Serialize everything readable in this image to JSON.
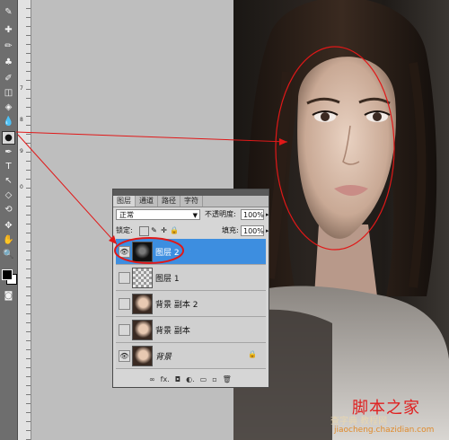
{
  "toolbar": {
    "tools": [
      {
        "name": "eyedropper-tool",
        "glyph": "✎"
      },
      {
        "name": "healing-tool",
        "glyph": "✚"
      },
      {
        "name": "brush-tool",
        "glyph": "✏"
      },
      {
        "name": "stamp-tool",
        "glyph": "♣"
      },
      {
        "name": "history-brush-tool",
        "glyph": "✐"
      },
      {
        "name": "eraser-tool",
        "glyph": "◫"
      },
      {
        "name": "bucket-tool",
        "glyph": "◈"
      },
      {
        "name": "blur-tool",
        "glyph": "💧"
      },
      {
        "name": "dodge-tool",
        "glyph": "●"
      },
      {
        "name": "pen-tool",
        "glyph": "✒"
      },
      {
        "name": "type-tool",
        "glyph": "T"
      },
      {
        "name": "path-select-tool",
        "glyph": "↖"
      },
      {
        "name": "shape-tool",
        "glyph": "◇"
      },
      {
        "name": "3d-rotate-tool",
        "glyph": "⟲"
      },
      {
        "name": "3d-orbit-tool",
        "glyph": "✥"
      },
      {
        "name": "hand-tool",
        "glyph": "✋"
      },
      {
        "name": "zoom-tool",
        "glyph": "🔍"
      }
    ],
    "active_tool": "dodge-tool"
  },
  "ruler": {
    "numbers": [
      "7",
      "8",
      "9",
      "0"
    ]
  },
  "layers_panel": {
    "tabs": [
      "图层",
      "通道",
      "路径",
      "字符"
    ],
    "active_tab": "图层",
    "blend_mode": "正常",
    "opacity_label": "不透明度:",
    "opacity_value": "100%",
    "lock_label": "锁定:",
    "fill_label": "填充:",
    "fill_value": "100%",
    "layers": [
      {
        "name": "图层 2",
        "visible": true,
        "selected": true,
        "thumb": "dark"
      },
      {
        "name": "图层 1",
        "visible": false,
        "selected": false,
        "thumb": "checker"
      },
      {
        "name": "背景 副本 2",
        "visible": false,
        "selected": false,
        "thumb": "face"
      },
      {
        "name": "背景 副本",
        "visible": false,
        "selected": false,
        "thumb": "face"
      },
      {
        "name": "背景",
        "visible": true,
        "selected": false,
        "thumb": "face",
        "locked": true
      }
    ],
    "footer_icons": [
      "link-icon",
      "fx-icon",
      "mask-icon",
      "adjustment-icon",
      "group-icon",
      "new-layer-icon",
      "trash-icon"
    ],
    "footer_labels": [
      "∞",
      "fx.",
      "◘",
      "◐.",
      "▭",
      "▫",
      "🗑"
    ]
  },
  "watermark": {
    "line1": "脚本之家",
    "line2": "查字典 教程网",
    "line3": "jiaocheng.chazidian.com"
  },
  "colors": {
    "annotation_red": "#e01818",
    "selection_blue": "#3d8ee0"
  }
}
